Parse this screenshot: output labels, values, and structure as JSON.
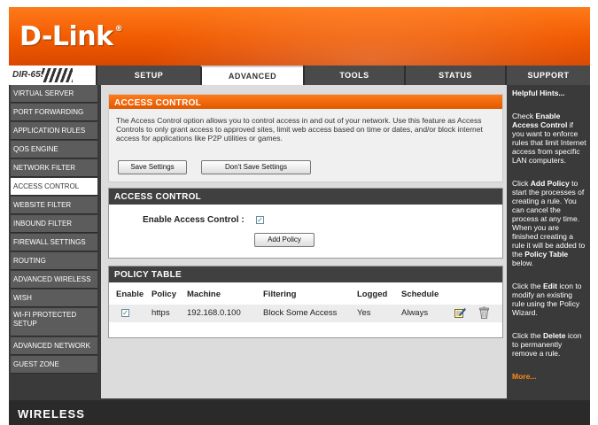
{
  "brand": {
    "logo": "D-Link",
    "reg": "®",
    "model": "DIR-655"
  },
  "tabs": [
    {
      "label": "SETUP"
    },
    {
      "label": "ADVANCED"
    },
    {
      "label": "TOOLS"
    },
    {
      "label": "STATUS"
    },
    {
      "label": "SUPPORT"
    }
  ],
  "sidebar": {
    "items": [
      {
        "label": "VIRTUAL SERVER"
      },
      {
        "label": "PORT FORWARDING"
      },
      {
        "label": "APPLICATION RULES"
      },
      {
        "label": "QOS ENGINE"
      },
      {
        "label": "NETWORK FILTER"
      },
      {
        "label": "ACCESS CONTROL"
      },
      {
        "label": "WEBSITE FILTER"
      },
      {
        "label": "INBOUND FILTER"
      },
      {
        "label": "FIREWALL SETTINGS"
      },
      {
        "label": "ROUTING"
      },
      {
        "label": "ADVANCED WIRELESS"
      },
      {
        "label": "WISH"
      },
      {
        "label": "WI-FI PROTECTED SETUP"
      },
      {
        "label": "ADVANCED NETWORK"
      },
      {
        "label": "GUEST ZONE"
      }
    ]
  },
  "intro": {
    "title": "ACCESS CONTROL",
    "text": "The Access Control option allows you to control access in and out of your network. Use this feature as Access Controls to only grant access to approved sites, limit web access based on time or dates, and/or block internet access for applications like P2P utilities or games.",
    "save_label": "Save Settings",
    "dont_save_label": "Don't Save Settings"
  },
  "access_control": {
    "title": "ACCESS CONTROL",
    "enable_label": "Enable Access Control :",
    "add_policy_label": "Add Policy"
  },
  "policy_table": {
    "title": "POLICY TABLE",
    "headers": [
      "Enable",
      "Policy",
      "Machine",
      "Filtering",
      "Logged",
      "Schedule"
    ],
    "rows": [
      {
        "policy": "https",
        "machine": "192.168.0.100",
        "filtering": "Block Some Access",
        "logged": "Yes",
        "schedule": "Always"
      }
    ]
  },
  "hints": {
    "title": "Helpful Hints...",
    "h1_pre": "Check ",
    "h1_bold": "Enable Access Control",
    "h1_post": " if you want to enforce rules that limit Internet access from specific LAN computers.",
    "h2_pre": "Click ",
    "h2_bold": "Add Policy",
    "h2_mid": " to start the processes of creating a rule. You can cancel the process at any time. When you are finished creating a rule it will be added to the ",
    "h2_bold2": "Policy Table",
    "h2_post": " below.",
    "h3_pre": "Click the ",
    "h3_bold": "Edit",
    "h3_post": " icon to modify an existing rule using the Policy Wizard.",
    "h4_pre": "Click the ",
    "h4_bold": "Delete",
    "h4_post": " icon to permanently remove a rule.",
    "more": "More..."
  },
  "footer": {
    "label": "WIRELESS"
  },
  "colors": {
    "accent": "#f05a00",
    "dark": "#3a3a3a",
    "check": "#2a8a2a"
  },
  "icons": {
    "edit": "edit-icon",
    "delete": "trash-icon",
    "check": "checkmark"
  }
}
